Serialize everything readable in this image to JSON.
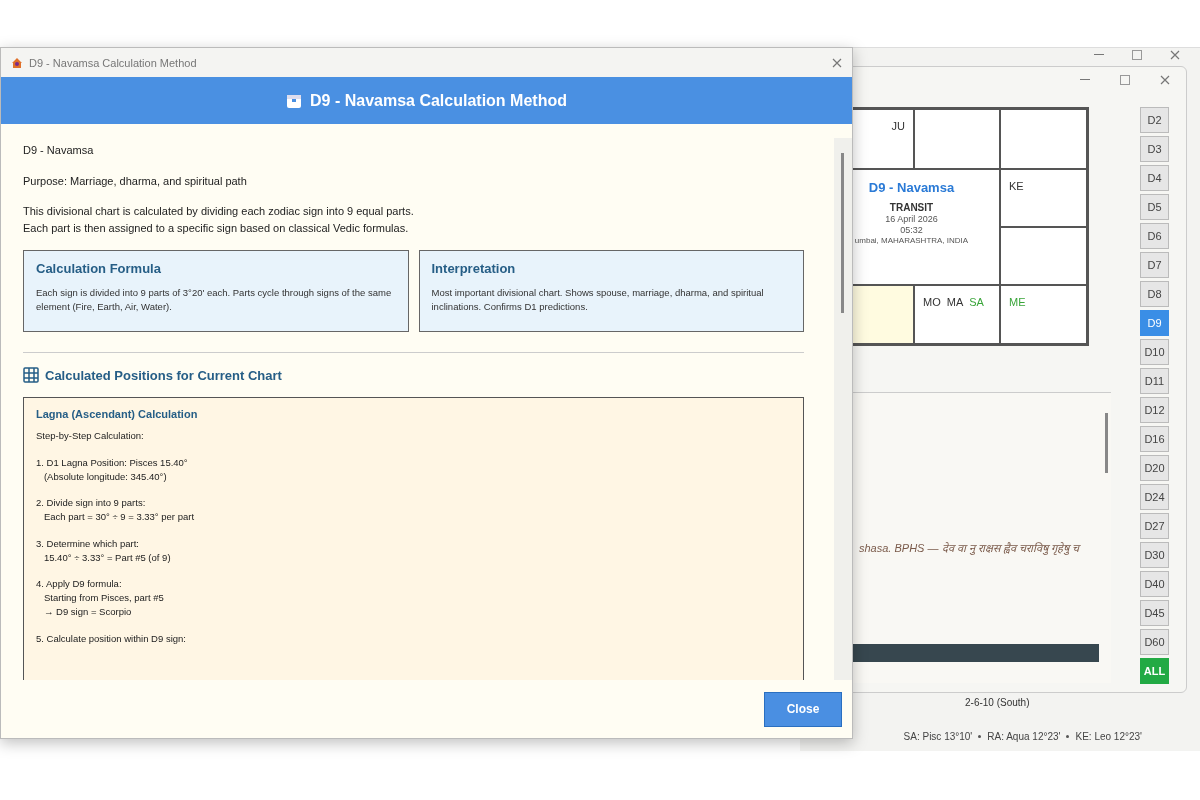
{
  "main_window": {
    "chart": {
      "title": "D9 - Navamsa",
      "mode": "TRANSIT",
      "date": "16 April 2026",
      "time": "05:32",
      "place": "umbai, MAHARASHTRA, INDIA",
      "cells": [
        {
          "planets": [
            {
              "name": "JU",
              "color": "#333333"
            }
          ]
        },
        {},
        {},
        {
          "planets": [
            {
              "name": "KE",
              "color": "#333333"
            }
          ]
        },
        {},
        {},
        {
          "planets": [
            {
              "name": "MO",
              "color": "#333333"
            },
            {
              "name": "MA",
              "color": "#333333"
            },
            {
              "name": "SA",
              "color": "#3aa53a"
            }
          ]
        },
        {
          "planets": [
            {
              "name": "ME",
              "color": "#3aa53a"
            }
          ]
        }
      ]
    },
    "divisions": [
      {
        "label": "D2",
        "selected": false
      },
      {
        "label": "D3",
        "selected": false
      },
      {
        "label": "D4",
        "selected": false
      },
      {
        "label": "D5",
        "selected": false
      },
      {
        "label": "D6",
        "selected": false
      },
      {
        "label": "D7",
        "selected": false
      },
      {
        "label": "D8",
        "selected": false
      },
      {
        "label": "D9",
        "selected": true
      },
      {
        "label": "D10",
        "selected": false
      },
      {
        "label": "D11",
        "selected": false
      },
      {
        "label": "D12",
        "selected": false
      },
      {
        "label": "D16",
        "selected": false
      },
      {
        "label": "D20",
        "selected": false
      },
      {
        "label": "D24",
        "selected": false
      },
      {
        "label": "D27",
        "selected": false
      },
      {
        "label": "D30",
        "selected": false
      },
      {
        "label": "D40",
        "selected": false
      },
      {
        "label": "D45",
        "selected": false
      },
      {
        "label": "D60",
        "selected": false
      },
      {
        "label": "ALL",
        "selected": false,
        "kind": "all"
      }
    ],
    "quote": "shasa. BPHS — देव वा नु राक्षस ह्वैव चराविषु गृहेषु च",
    "chart_style": "2-6-10 (South)",
    "status_items": [
      "SA: Pisc 13°10'",
      "RA: Aqua 12°23'",
      "KE: Leo 12°23'"
    ]
  },
  "dialog": {
    "window_title": "D9 - Navamsa Calculation Method",
    "header": "D9 - Navamsa Calculation Method",
    "intro": [
      "D9 - Navamsa",
      "Purpose: Marriage, dharma, and spiritual path",
      "This divisional chart is calculated by dividing each zodiac sign into 9 equal parts.\nEach part is then assigned to a specific sign based on classical Vedic formulas."
    ],
    "cards": [
      {
        "title": "Calculation Formula",
        "text": "Each sign is divided into 9 parts of 3°20' each. Parts cycle through signs of the same element (Fire, Earth, Air, Water)."
      },
      {
        "title": "Interpretation",
        "text": "Most important divisional chart. Shows spouse, marriage, dharma, and spiritual inclinations. Confirms D1 predictions."
      }
    ],
    "section_title": "Calculated Positions for Current Chart",
    "calc_title": "Lagna (Ascendant) Calculation",
    "calc_lines": [
      "Step-by-Step Calculation:",
      "1. D1 Lagna Position: Pisces 15.40°\n   (Absolute longitude: 345.40°)",
      "2. Divide sign into 9 parts:\n   Each part = 30° ÷ 9 = 3.33° per part",
      "3. Determine which part:\n   15.40° ÷ 3.33° = Part #5 (of 9)",
      "4. Apply D9 formula:\n   Starting from Pisces, part #5\n   → D9 sign = Scorpio",
      "5. Calculate position within D9 sign:"
    ],
    "close_button": "Close"
  }
}
